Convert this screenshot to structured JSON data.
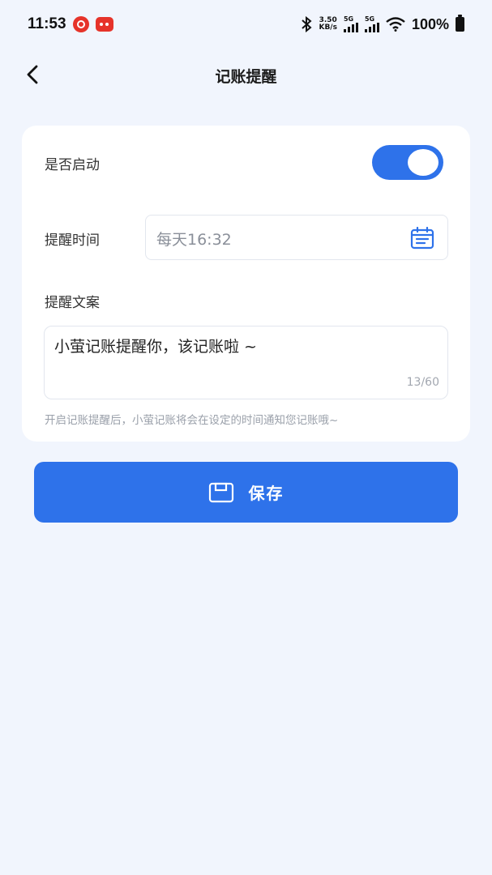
{
  "status_bar": {
    "time": "11:53",
    "net_speed_value": "3.50",
    "net_speed_unit": "KB/s",
    "signal1_tag": "5G",
    "signal2_tag": "5G",
    "battery": "100%"
  },
  "header": {
    "title": "记账提醒"
  },
  "form": {
    "enable_label": "是否启动",
    "enable_state": "on",
    "time_label": "提醒时间",
    "time_value": "每天16:32",
    "text_label": "提醒文案",
    "text_value": "小萤记账提醒你，该记账啦 ~",
    "char_count": "13/60",
    "hint": "开启记账提醒后，小萤记账将会在设定的时间通知您记账哦~"
  },
  "actions": {
    "save_label": "保存"
  },
  "colors": {
    "accent": "#2e72ea",
    "background": "#f1f5fd"
  },
  "icons": [
    "back-arrow-icon",
    "calendar-icon",
    "save-disk-icon",
    "bluetooth-icon",
    "wifi-icon",
    "battery-icon"
  ]
}
